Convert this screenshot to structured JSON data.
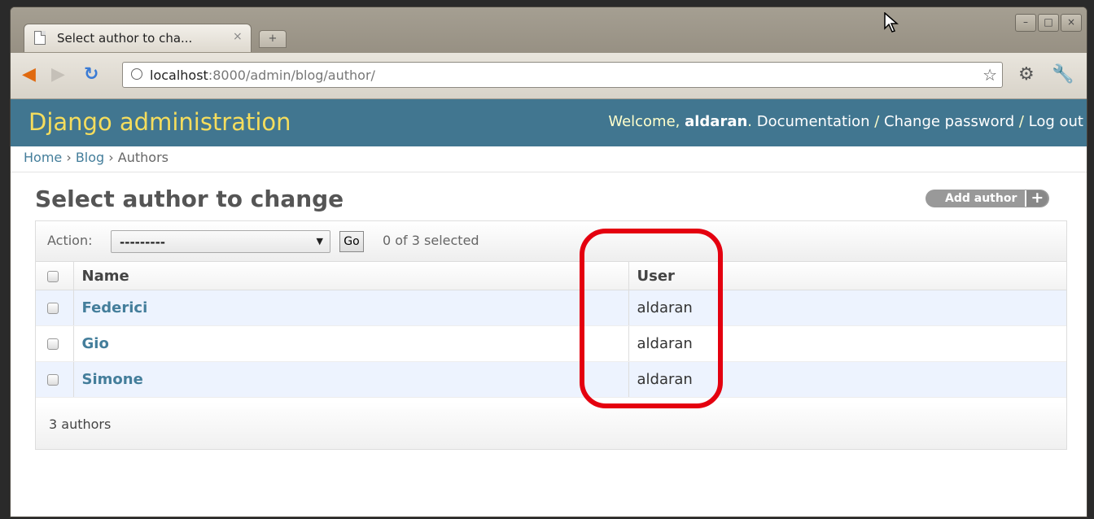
{
  "browser": {
    "tab_title": "Select author to cha...",
    "tab_close": "×",
    "new_tab": "+",
    "url_host": "localhost",
    "url_path": ":8000/admin/blog/author/",
    "window_buttons": [
      "–",
      "□",
      "×"
    ]
  },
  "header": {
    "branding": "Django administration",
    "welcome": "Welcome, ",
    "username": "aldaran",
    "links": [
      "Documentation",
      "Change password",
      "Log out"
    ],
    "separator": " / "
  },
  "breadcrumbs": {
    "home": "Home",
    "blog": "Blog",
    "current": "Authors",
    "sep": " › "
  },
  "content": {
    "title": "Select author to change",
    "add_button": "Add author"
  },
  "actions": {
    "label": "Action:",
    "selected_value": "---------",
    "go_label": "Go",
    "selection_count": "0 of 3 selected"
  },
  "table": {
    "headers": [
      "Name",
      "User"
    ],
    "rows": [
      {
        "name": "Federici",
        "user": "aldaran"
      },
      {
        "name": "Gio",
        "user": "aldaran"
      },
      {
        "name": "Simone",
        "user": "aldaran"
      }
    ]
  },
  "paginator": "3 authors",
  "colors": {
    "header_bg": "#417690",
    "branding": "#f5dd5d",
    "link": "#447e9b",
    "highlight": "#e4000f"
  }
}
